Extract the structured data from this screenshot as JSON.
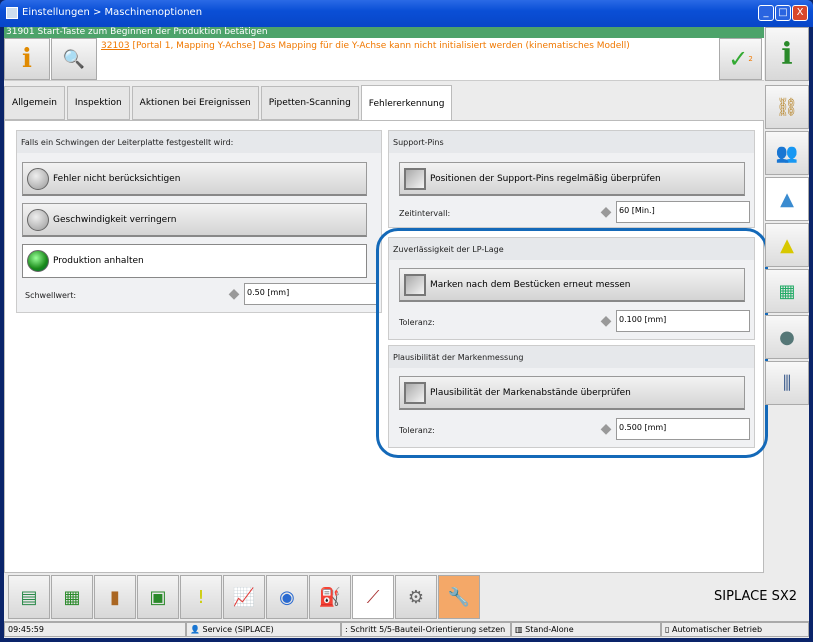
{
  "window": {
    "title": "Einstellungen > Maschinenoptionen",
    "minimize": "_",
    "maximize": "□",
    "close": "X"
  },
  "status_message": "31901 Start-Taste zum Beginnen der Produktion betätigen",
  "error_message": {
    "code": "32103",
    "text": " [Portal 1, Mapping Y-Achse] Das Mapping für die Y-Achse kann nicht initialisiert werden (kinematisches Modell)"
  },
  "ack_count": "2",
  "tabs": [
    {
      "label": "Allgemein"
    },
    {
      "label": "Inspektion"
    },
    {
      "label": "Aktionen bei Ereignissen"
    },
    {
      "label": "Pipetten-Scanning"
    },
    {
      "label": "Fehlererkennung",
      "active": true
    }
  ],
  "vibration": {
    "title": "Falls ein Schwingen der Leiterplatte festgestellt wird:",
    "options": [
      {
        "label": "Fehler nicht berücksichtigen",
        "selected": false
      },
      {
        "label": "Geschwindigkeit verringern",
        "selected": false
      },
      {
        "label": "Produktion anhalten",
        "selected": true
      }
    ],
    "threshold_label": "Schwellwert:",
    "threshold_value": "0.50 [mm]"
  },
  "support_pins": {
    "title": "Support-Pins",
    "check_label": "Positionen der Support-Pins regelmäßig überprüfen",
    "checked": false,
    "interval_label": "Zeitintervall:",
    "interval_value": "60 [Min.]"
  },
  "lp_position": {
    "title": "Zuverlässigkeit der LP-Lage",
    "check_label": "Marken nach dem Bestücken erneut messen",
    "checked": false,
    "tolerance_label": "Toleranz:",
    "tolerance_value": "0.100 [mm]"
  },
  "mark_plausibility": {
    "title": "Plausibilität der Markenmessung",
    "check_label": "Plausibilität der Markenabstände überprüfen",
    "checked": false,
    "tolerance_label": "Toleranz:",
    "tolerance_value": "0.500 [mm]"
  },
  "highlight_color": "#1469b8",
  "brand": "SIPLACE SX2",
  "statusbar": {
    "time": "09:45:59",
    "user": "Service (SIPLACE)",
    "step": ": Schritt 5/5-Bauteil-Orientierung setzen",
    "mode": "Stand-Alone",
    "operation": "Automatischer Betrieb"
  }
}
